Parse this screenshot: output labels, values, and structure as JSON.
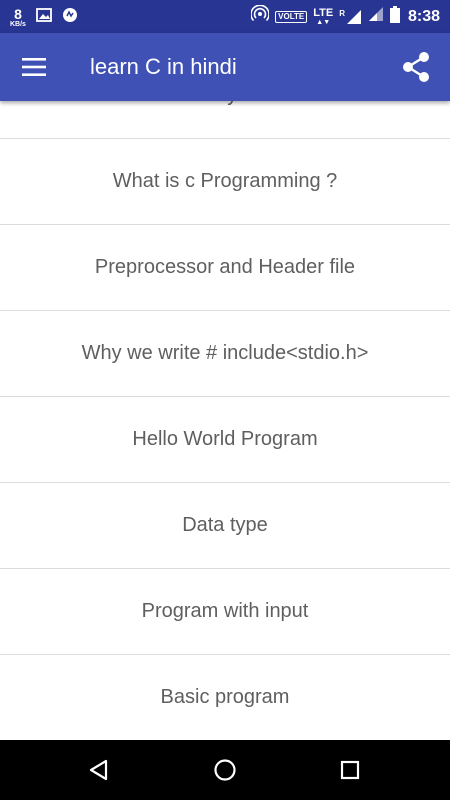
{
  "status_bar": {
    "net_speed_value": "8",
    "net_speed_unit": "KB/s",
    "network_label": "VOLTE",
    "lte_label": "LTE",
    "roaming_label": "R",
    "time": "8:38",
    "icons": [
      "gallery-icon",
      "sync-app-icon",
      "hotspot-icon",
      "signal-icon",
      "battery-icon"
    ]
  },
  "app_bar": {
    "title": "learn C in hindi",
    "menu_icon": "hamburger-menu-icon",
    "share_icon": "share-icon",
    "background": "#3f51b5",
    "status_background": "#283593"
  },
  "topics": [
    "History of c",
    "What is c Programming ?",
    "Preprocessor and Header file",
    "Why we write # include<stdio.h>",
    "Hello World Program",
    "Data type",
    "Program with input",
    "Basic program"
  ],
  "nav_bar": {
    "buttons": [
      "back-icon",
      "home-icon",
      "recents-icon"
    ]
  }
}
